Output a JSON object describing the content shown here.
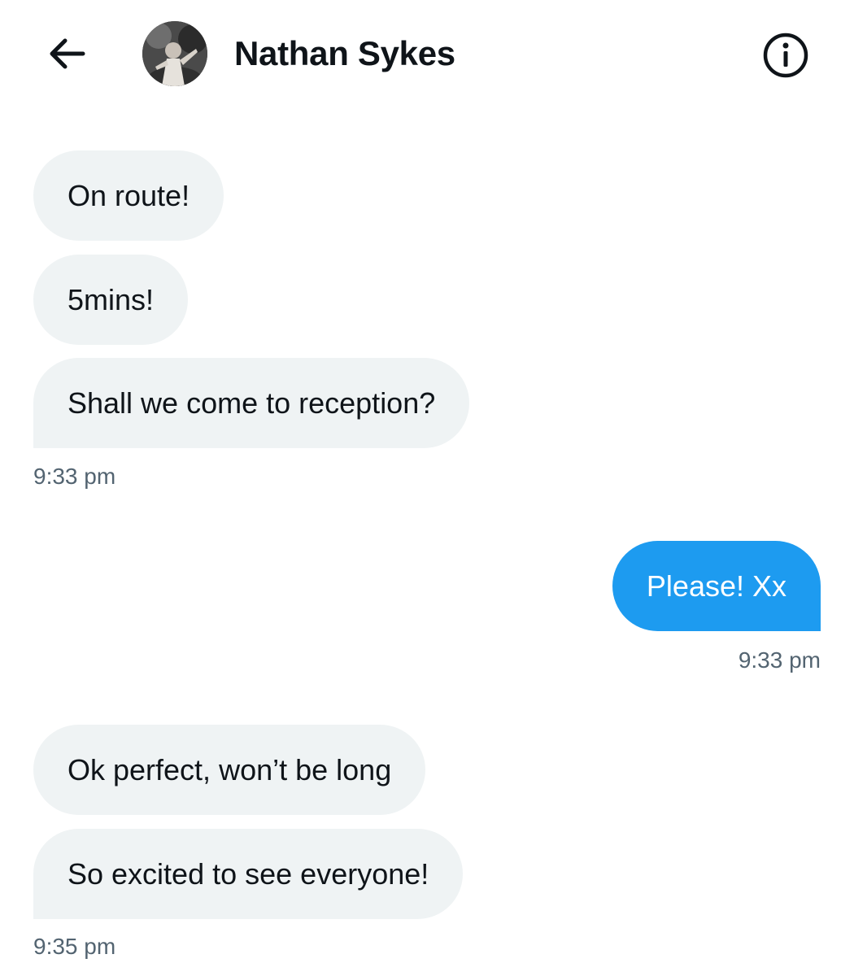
{
  "header": {
    "back_icon": "arrow-left-icon",
    "contact_name": "Nathan Sykes",
    "info_icon": "info-circle-icon"
  },
  "messages": [
    {
      "direction": "incoming",
      "text": "On route!"
    },
    {
      "direction": "incoming",
      "text": "5mins!"
    },
    {
      "direction": "incoming",
      "text": "Shall we come to reception?",
      "time": "9:33 pm"
    },
    {
      "direction": "outgoing",
      "text": "Please! Xx",
      "time": "9:33 pm"
    },
    {
      "direction": "incoming",
      "text": "Ok perfect, won’t be long"
    },
    {
      "direction": "incoming",
      "text": "So excited to see everyone!",
      "time": "9:35 pm"
    }
  ],
  "colors": {
    "incoming_bubble": "#eff3f4",
    "outgoing_bubble": "#1d9bf0",
    "timestamp_text": "#536471",
    "primary_text": "#0f1419"
  }
}
